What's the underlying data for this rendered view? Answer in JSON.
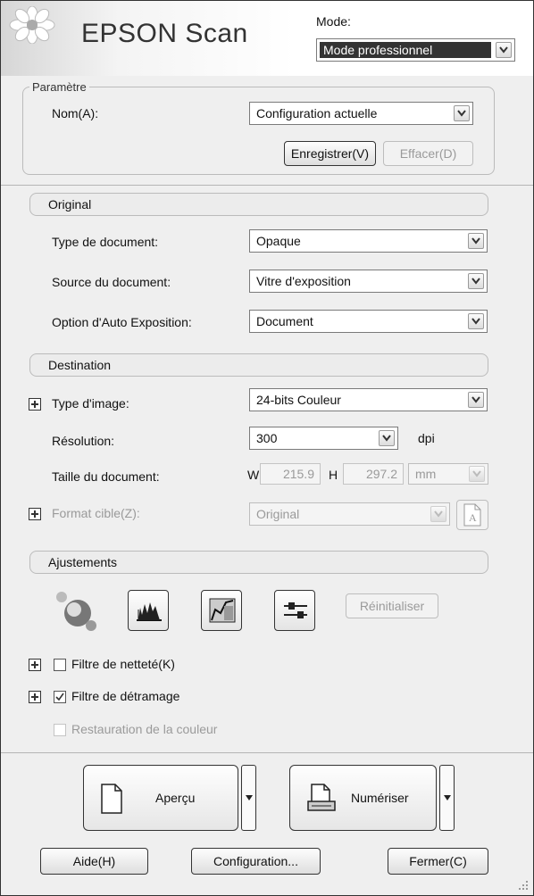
{
  "header": {
    "brand": "EPSON Scan",
    "mode_label": "Mode:",
    "mode_value": "Mode professionnel"
  },
  "parametre": {
    "group_title": "Paramètre",
    "name_label": "Nom(A):",
    "name_value": "Configuration actuelle",
    "save_button": "Enregistrer(V)",
    "delete_button": "Effacer(D)"
  },
  "original": {
    "section_title": "Original",
    "doc_type_label": "Type de document:",
    "doc_type_value": "Opaque",
    "doc_source_label": "Source du document:",
    "doc_source_value": "Vitre d'exposition",
    "auto_exposure_label": "Option d'Auto Exposition:",
    "auto_exposure_value": "Document"
  },
  "destination": {
    "section_title": "Destination",
    "image_type_label": "Type d'image:",
    "image_type_value": "24-bits Couleur",
    "resolution_label": "Résolution:",
    "resolution_value": "300",
    "resolution_unit": "dpi",
    "doc_size_label": "Taille du document:",
    "width_label": "W",
    "width_value": "215.9",
    "height_label": "H",
    "height_value": "297.2",
    "size_unit": "mm",
    "target_format_label": "Format cible(Z):",
    "target_format_value": "Original"
  },
  "ajustements": {
    "section_title": "Ajustements",
    "reset_button": "Réinitialiser",
    "sharpen_label": "Filtre de netteté(K)",
    "sharpen_checked": false,
    "descreen_label": "Filtre de détramage",
    "descreen_checked": true,
    "color_restore_label": "Restauration de la couleur",
    "color_restore_checked": false
  },
  "actions": {
    "preview_button": "Aperçu",
    "scan_button": "Numériser",
    "help_button": "Aide(H)",
    "config_button": "Configuration...",
    "close_button": "Fermer(C)"
  }
}
